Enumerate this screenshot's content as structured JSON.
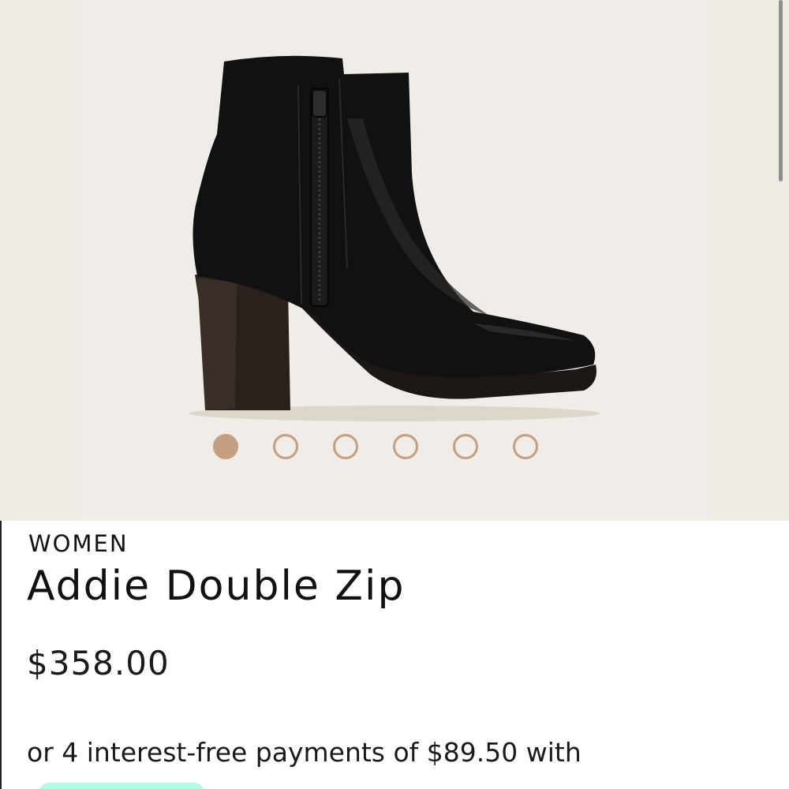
{
  "product": {
    "category": "WOMEN",
    "name": "Addie Double Zip",
    "price": "$358.00",
    "installments_text": "or 4 interest-free payments of $89.50 with"
  },
  "gallery": {
    "image_count": 6,
    "active_index": 0,
    "dot_color": "#c59f80",
    "background_color": "#efebe5"
  },
  "badge": {
    "color": "#b2fce4"
  }
}
